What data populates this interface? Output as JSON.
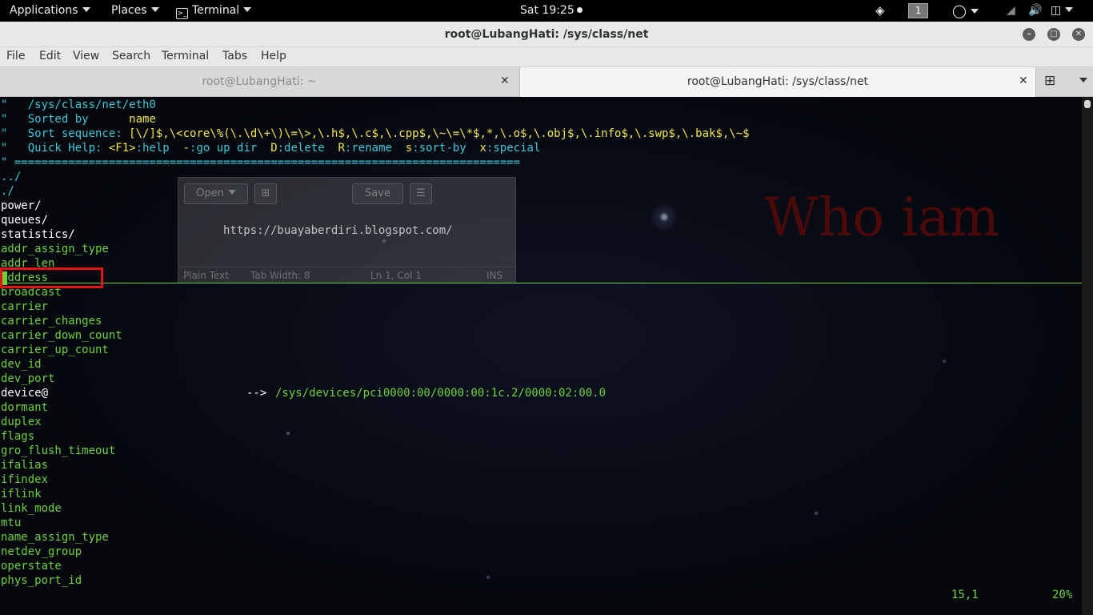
{
  "topbar": {
    "applications": "Applications",
    "places": "Places",
    "terminal": "Terminal",
    "clock": "Sat 19:25",
    "workspace": "1"
  },
  "window": {
    "title": "root@LubangHati: /sys/class/net"
  },
  "menu": [
    "File",
    "Edit",
    "View",
    "Search",
    "Terminal",
    "Tabs",
    "Help"
  ],
  "tabs": [
    {
      "label": "root@LubangHati: ~",
      "active": false
    },
    {
      "label": "root@LubangHati: /sys/class/net",
      "active": true
    }
  ],
  "netrw_header": {
    "path_line": "\"   /sys/class/net/eth0",
    "sorted_prefix": "\"   Sorted by      ",
    "sorted_value": "name",
    "sort_prefix": "\"   Sort sequence: ",
    "sort_value": "[\\/]$,\\<core\\%(\\.\\d\\+\\)\\=\\>,\\.h$,\\.c$,\\.cpp$,\\~\\=\\*$,*,\\.o$,\\.obj$,\\.info$,\\.swp$,\\.bak$,\\~$",
    "quick_help": [
      {
        "text": "\"   Quick Help: ",
        "color": "cyan"
      },
      {
        "text": "<F1>",
        "color": "yellow"
      },
      {
        "text": ":help  ",
        "color": "cyan"
      },
      {
        "text": "-",
        "color": "yellow"
      },
      {
        "text": ":go up dir  ",
        "color": "cyan"
      },
      {
        "text": "D",
        "color": "yellow"
      },
      {
        "text": ":delete  ",
        "color": "cyan"
      },
      {
        "text": "R",
        "color": "yellow"
      },
      {
        "text": ":rename  ",
        "color": "cyan"
      },
      {
        "text": "s",
        "color": "yellow"
      },
      {
        "text": ":sort-by  ",
        "color": "cyan"
      },
      {
        "text": "x",
        "color": "yellow"
      },
      {
        "text": ":special",
        "color": "cyan"
      }
    ],
    "separator": "\" ==========================================================================="
  },
  "entries": [
    {
      "name": "../",
      "color": "cyan"
    },
    {
      "name": "./",
      "color": "cyan"
    },
    {
      "name": "power/",
      "color": "white"
    },
    {
      "name": "queues/",
      "color": "white"
    },
    {
      "name": "statistics/",
      "color": "white"
    },
    {
      "name": "addr_assign_type",
      "color": "green"
    },
    {
      "name": "addr_len",
      "color": "green"
    },
    {
      "name": "address",
      "color": "green"
    },
    {
      "name": "broadcast",
      "color": "green"
    },
    {
      "name": "carrier",
      "color": "green"
    },
    {
      "name": "carrier_changes",
      "color": "green"
    },
    {
      "name": "carrier_down_count",
      "color": "green"
    },
    {
      "name": "carrier_up_count",
      "color": "green"
    },
    {
      "name": "dev_id",
      "color": "green"
    },
    {
      "name": "dev_port",
      "color": "green"
    },
    {
      "name": "device@",
      "color": "white",
      "link_arrow": "-->",
      "link_target": "/sys/devices/pci0000:00/0000:00:1c.2/0000:02:00.0"
    },
    {
      "name": "dormant",
      "color": "green"
    },
    {
      "name": "duplex",
      "color": "green"
    },
    {
      "name": "flags",
      "color": "green"
    },
    {
      "name": "gro_flush_timeout",
      "color": "green"
    },
    {
      "name": "ifalias",
      "color": "green"
    },
    {
      "name": "ifindex",
      "color": "green"
    },
    {
      "name": "iflink",
      "color": "green"
    },
    {
      "name": "link_mode",
      "color": "green"
    },
    {
      "name": "mtu",
      "color": "green"
    },
    {
      "name": "name_assign_type",
      "color": "green"
    },
    {
      "name": "netdev_group",
      "color": "green"
    },
    {
      "name": "operstate",
      "color": "green"
    },
    {
      "name": "phys_port_id",
      "color": "green"
    }
  ],
  "status": {
    "position": "15,1",
    "percent": "20%"
  },
  "wallpaper_text": "Who iam",
  "ghost_window": {
    "open_label": "Open",
    "save_label": "Save",
    "url": "https://buayaberdiri.blogspot.com/",
    "status_plain": "Plain Text",
    "status_tab": "Tab Width: 8",
    "status_pos": "Ln 1, Col 1",
    "status_ins": "INS"
  },
  "colors": {
    "cyan": "#3bc7d8",
    "yellow": "#f2e64a",
    "green": "#6ad13a",
    "white": "#ffffff",
    "highlight": "#e31414"
  }
}
